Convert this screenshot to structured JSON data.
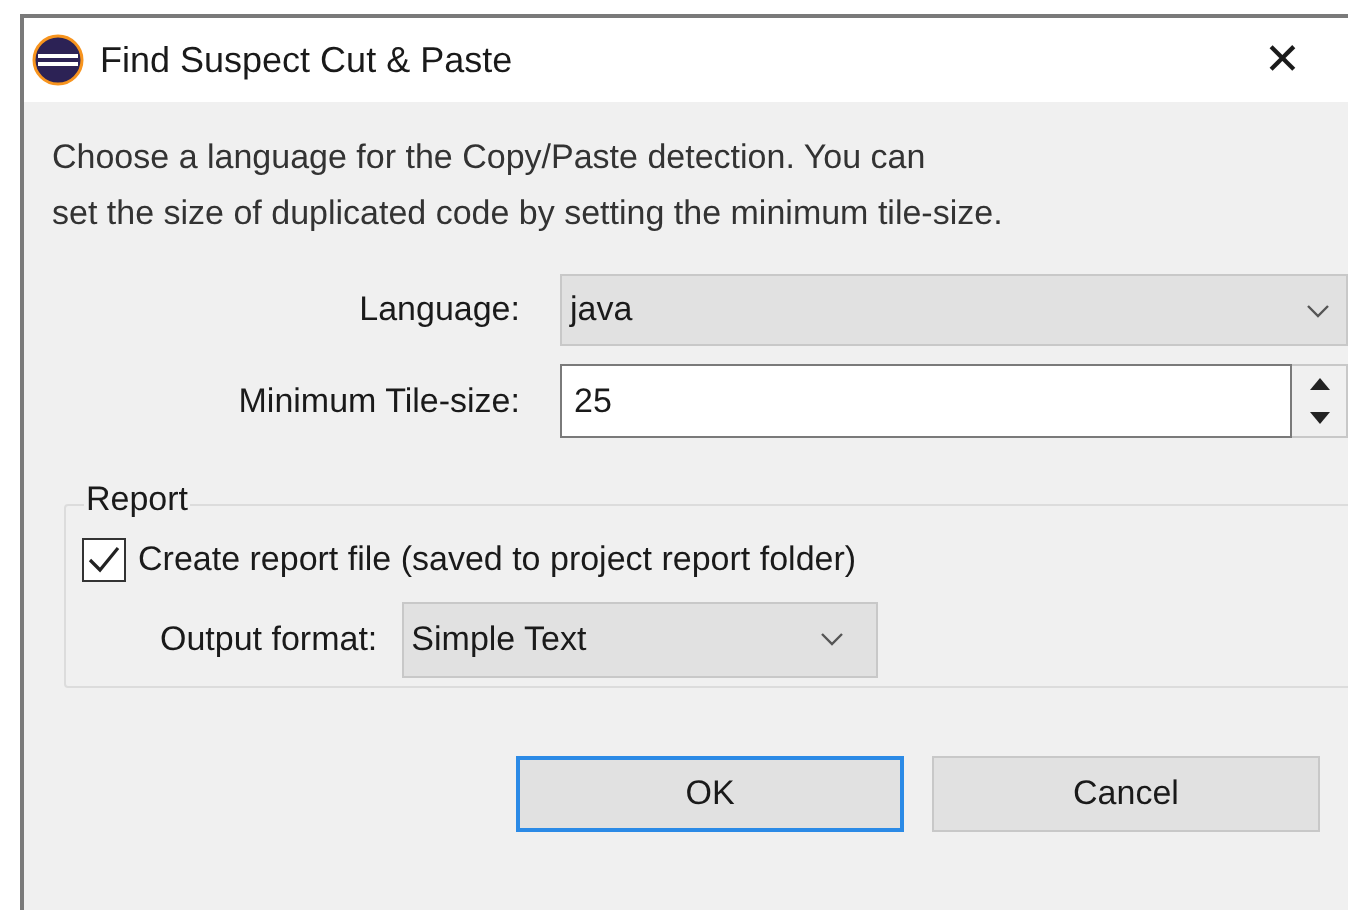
{
  "window": {
    "title": "Find Suspect Cut & Paste",
    "close": "✕"
  },
  "description": "Choose a language for the Copy/Paste detection. You can\nset the size of duplicated code by setting the minimum tile-size.",
  "language": {
    "label": "Language:",
    "value": "java"
  },
  "tile_size": {
    "label": "Minimum Tile-size:",
    "value": "25"
  },
  "report": {
    "title": "Report",
    "checkbox": {
      "label": "Create report file (saved to project report folder)",
      "checked": true
    },
    "output_format": {
      "label": "Output format:",
      "value": "Simple Text"
    }
  },
  "buttons": [
    {
      "label": "OK",
      "focused": true
    },
    {
      "label": "Cancel",
      "focused": false
    }
  ]
}
